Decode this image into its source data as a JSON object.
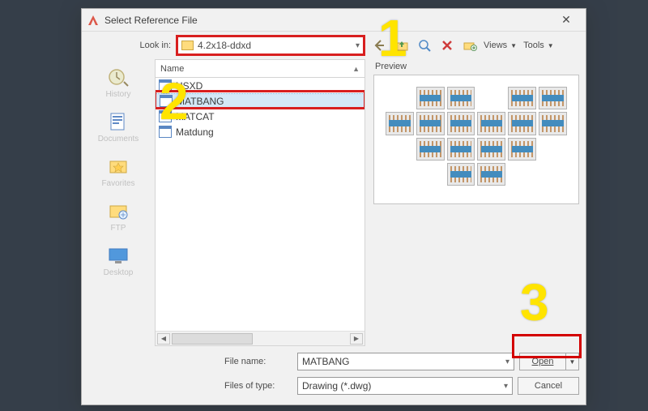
{
  "dialog": {
    "title": "Select Reference File",
    "lookin_label": "Look in:",
    "lookin_value": "4.2x18-ddxd",
    "views_label": "Views",
    "tools_label": "Tools"
  },
  "places": [
    {
      "name": "history",
      "label": "History"
    },
    {
      "name": "documents",
      "label": "Documents"
    },
    {
      "name": "favorites",
      "label": "Favorites"
    },
    {
      "name": "ftp",
      "label": "FTP"
    },
    {
      "name": "desktop",
      "label": "Desktop"
    }
  ],
  "file_list": {
    "header": "Name",
    "items": [
      {
        "label": "HSXD",
        "selected": false
      },
      {
        "label": "MATBANG",
        "selected": true
      },
      {
        "label": "MATCAT",
        "selected": false
      },
      {
        "label": "Matdung",
        "selected": false
      }
    ]
  },
  "preview_label": "Preview",
  "filename": {
    "label": "File name:",
    "value": "MATBANG"
  },
  "filetype": {
    "label": "Files of type:",
    "value": "Drawing (*.dwg)"
  },
  "buttons": {
    "open": "Open",
    "cancel": "Cancel"
  },
  "annotations": {
    "1": "1",
    "2": "2",
    "3": "3"
  },
  "highlight_color": "#d30000"
}
